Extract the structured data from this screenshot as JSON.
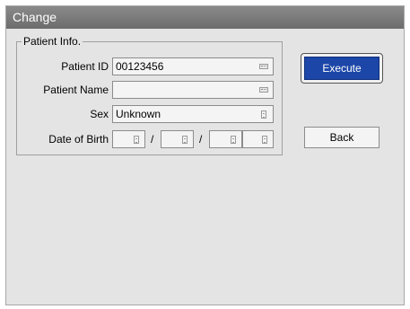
{
  "window": {
    "title": "Change"
  },
  "patient_info": {
    "group_label": "Patient Info.",
    "patient_id": {
      "label": "Patient ID",
      "value": "00123456"
    },
    "patient_name": {
      "label": "Patient Name",
      "value": ""
    },
    "sex": {
      "label": "Sex",
      "value": "Unknown"
    },
    "date_of_birth": {
      "label": "Date of Birth",
      "separator": "/"
    }
  },
  "buttons": {
    "execute": "Execute",
    "back": "Back"
  },
  "colors": {
    "execute_bg": "#1c46a8",
    "title_bar": "#7a7a7a",
    "panel_bg": "#e4e4e4"
  },
  "icons": {
    "keyboard": "keyboard-icon",
    "list": "list-icon"
  }
}
